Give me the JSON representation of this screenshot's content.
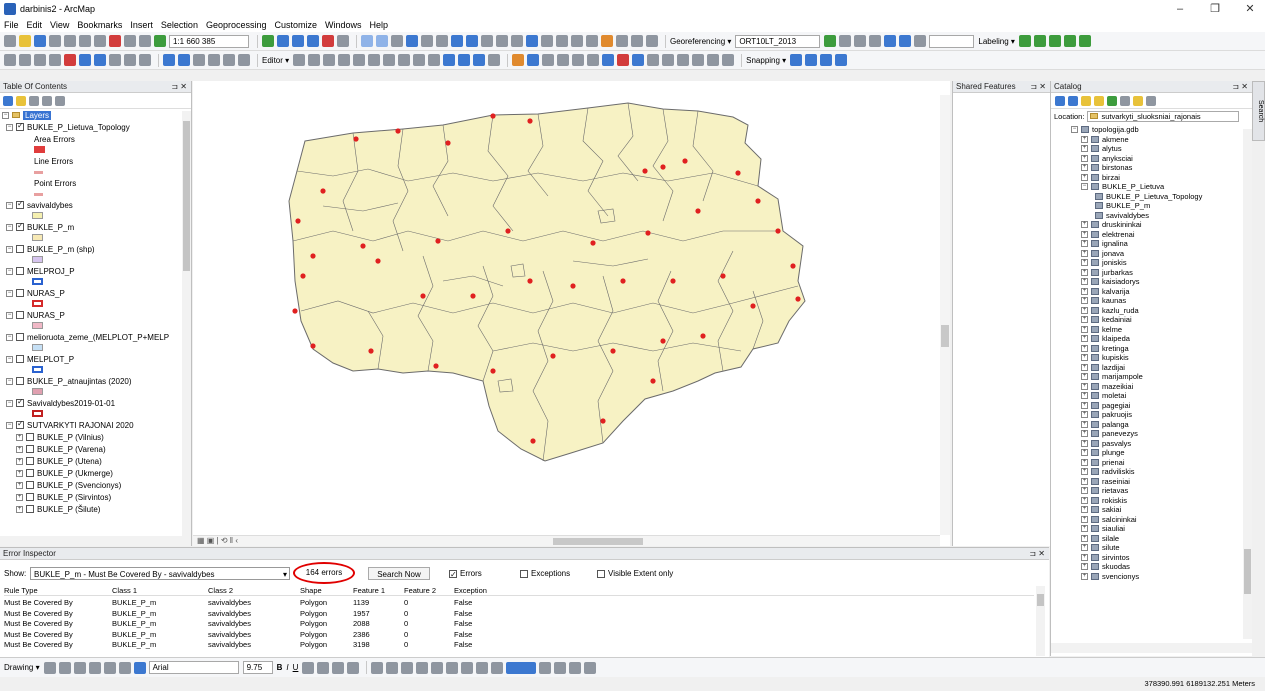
{
  "window": {
    "title": "darbinis2 - ArcMap",
    "min_glyph": "–",
    "max_glyph": "❐",
    "close_glyph": "✕"
  },
  "menu": [
    "File",
    "Edit",
    "View",
    "Bookmarks",
    "Insert",
    "Selection",
    "Geoprocessing",
    "Customize",
    "Windows",
    "Help"
  ],
  "toolbar": {
    "scale": "1:1 660 385",
    "georef_label": "Georeferencing ▾",
    "georef_layer": "ORT10LT_2013",
    "labeling_label": "Labeling ▾",
    "editor_label": "Editor ▾",
    "snapping_label": "Snapping ▾"
  },
  "toc": {
    "title": "Table Of Contents",
    "items": [
      {
        "label": "Layers",
        "checked": null,
        "toggle": "⊟",
        "indent": 0,
        "highlight": true
      },
      {
        "label": "BUKLE_P_Lietuva_Topology",
        "checked": true,
        "toggle": "⊟",
        "indent": 1
      },
      {
        "label": "Area Errors",
        "indent": 3,
        "symbol": "#e03c3c"
      },
      {
        "label": "Line Errors",
        "indent": 3,
        "symbol": "#e8a0a0"
      },
      {
        "label": "Point Errors",
        "indent": 3,
        "symbol": "#e8a0a0"
      },
      {
        "label": "savivaldybes",
        "checked": true,
        "toggle": "⊟",
        "indent": 1,
        "symbol": "#f5f0b0"
      },
      {
        "label": "BUKLE_P_m",
        "checked": true,
        "toggle": "⊟",
        "indent": 1,
        "symbol": "#f7e9b5"
      },
      {
        "label": "BUKLE_P_m (shp)",
        "checked": false,
        "toggle": "⊟",
        "indent": 1,
        "symbol": "#d6c4ee"
      },
      {
        "label": "MELPROJ_P",
        "checked": false,
        "toggle": "⊟",
        "indent": 1,
        "symbol": "#2a62d0"
      },
      {
        "label": "NURAS_P",
        "checked": false,
        "toggle": "⊟",
        "indent": 1,
        "symbol": "#d42a2a"
      },
      {
        "label": "NURAS_P",
        "checked": false,
        "toggle": "⊟",
        "indent": 1,
        "symbol": "#f0b8c6"
      },
      {
        "label": "melioruota_zeme_(MELPLOT_P+MELP",
        "checked": false,
        "toggle": "⊟",
        "indent": 1,
        "symbol": "#c6e0f5"
      },
      {
        "label": "MELPLOT_P",
        "checked": false,
        "toggle": "⊟",
        "indent": 1,
        "symbol": "#2a62d0"
      },
      {
        "label": "BUKLE_P_atnaujintas (2020)",
        "checked": false,
        "toggle": "⊟",
        "indent": 1,
        "symbol": "#e0a0b0"
      },
      {
        "label": "Savivaldybes2019-01-01",
        "checked": true,
        "toggle": "⊟",
        "indent": 1,
        "symbol": "#c02020"
      },
      {
        "label": "SUTVARKYTI RAJONAI 2020",
        "checked": true,
        "toggle": "⊟",
        "indent": 1
      },
      {
        "label": "BUKLE_P (Vilnius)",
        "checked": false,
        "toggle": "⊞",
        "indent": 2
      },
      {
        "label": "BUKLE_P (Varena)",
        "checked": false,
        "toggle": "⊞",
        "indent": 2
      },
      {
        "label": "BUKLE_P (Utena)",
        "checked": false,
        "toggle": "⊞",
        "indent": 2
      },
      {
        "label": "BUKLE_P (Ukmerge)",
        "checked": false,
        "toggle": "⊞",
        "indent": 2
      },
      {
        "label": "BUKLE_P (Svencionys)",
        "checked": false,
        "toggle": "⊞",
        "indent": 2
      },
      {
        "label": "BUKLE_P (Sirvintos)",
        "checked": false,
        "toggle": "⊞",
        "indent": 2
      },
      {
        "label": "BUKLE_P (Šilute)",
        "checked": false,
        "toggle": "⊞",
        "indent": 2
      }
    ]
  },
  "shared_features": {
    "title": "Shared Features"
  },
  "catalog": {
    "title": "Catalog",
    "location_label": "Location:",
    "location_value": "sutvarkyti_sluoksniai_rajonais",
    "root": "topologija.gdb",
    "feature_dataset": "BUKLE_P_Lietuva",
    "dataset_children": [
      "BUKLE_P_Lietuva_Topology",
      "BUKLE_P_m",
      "savivaldybes"
    ],
    "items_before": [
      "akmene",
      "alytus",
      "anyksciai",
      "birstonas",
      "birzai"
    ],
    "items_after": [
      "druskininkai",
      "elektrenai",
      "ignalina",
      "jonava",
      "joniskis",
      "jurbarkas",
      "kaisiadorys",
      "kalvarija",
      "kaunas",
      "kazlu_ruda",
      "kedainiai",
      "kelme",
      "klaipeda",
      "kretinga",
      "kupiskis",
      "lazdijai",
      "marijampole",
      "mazeikiai",
      "moletai",
      "pagegiai",
      "pakruojis",
      "palanga",
      "panevezys",
      "pasvalys",
      "plunge",
      "prienai",
      "radviliskis",
      "raseiniai",
      "rietavas",
      "rokiskis",
      "sakiai",
      "salcininkai",
      "siauliai",
      "silale",
      "silute",
      "sirvintos",
      "skuodas",
      "svencionys"
    ]
  },
  "search_tab": "Search",
  "error_inspector": {
    "title": "Error Inspector",
    "show_label": "Show:",
    "show_value": "BUKLE_P_m - Must Be Covered By - savivaldybes",
    "error_count": "164 errors",
    "search_button": "Search Now",
    "errors_label": "Errors",
    "errors_checked": true,
    "exceptions_label": "Exceptions",
    "visible_extent_label": "Visible Extent only",
    "columns": [
      "Rule Type",
      "Class 1",
      "Class 2",
      "Shape",
      "Feature 1",
      "Feature 2",
      "Exception"
    ],
    "rows": [
      [
        "Must Be Covered By",
        "BUKLE_P_m",
        "savivaldybes",
        "Polygon",
        "1139",
        "0",
        "False"
      ],
      [
        "Must Be Covered By",
        "BUKLE_P_m",
        "savivaldybes",
        "Polygon",
        "1957",
        "0",
        "False"
      ],
      [
        "Must Be Covered By",
        "BUKLE_P_m",
        "savivaldybes",
        "Polygon",
        "2088",
        "0",
        "False"
      ],
      [
        "Must Be Covered By",
        "BUKLE_P_m",
        "savivaldybes",
        "Polygon",
        "2386",
        "0",
        "False"
      ],
      [
        "Must Be Covered By",
        "BUKLE_P_m",
        "savivaldybes",
        "Polygon",
        "3198",
        "0",
        "False"
      ]
    ]
  },
  "drawing": {
    "label": "Drawing ▾",
    "font": "Arial",
    "font_size": "9.75"
  },
  "status": {
    "coords": "378390.991  6189132.251 Meters"
  },
  "colors": {
    "map_fill": "#f7f2c4",
    "map_stroke": "#6b6b6b",
    "error_red": "#e02020",
    "highlight_circle": "#e00000"
  }
}
